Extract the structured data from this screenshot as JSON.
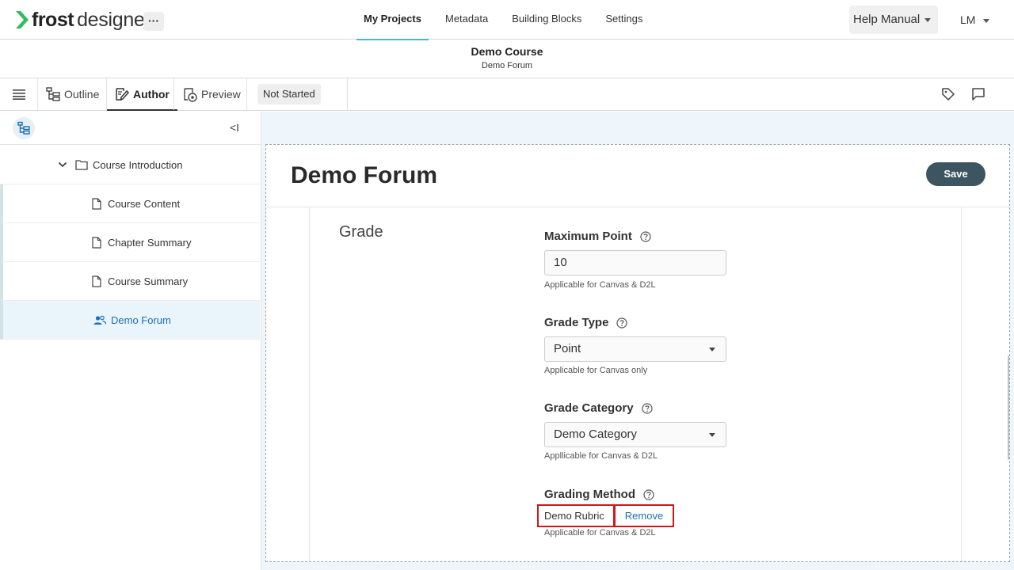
{
  "app": {
    "logo_bold": "frost",
    "logo_light": "designer",
    "more_label": "···"
  },
  "nav": {
    "items": [
      "My Projects",
      "Metadata",
      "Building Blocks",
      "Settings"
    ],
    "active": "My Projects"
  },
  "header_right": {
    "help_label": "Help Manual",
    "user_initials": "LM"
  },
  "course": {
    "title": "Demo Course",
    "subtitle": "Demo Forum"
  },
  "toolbar": {
    "outline_label": "Outline",
    "author_label": "Author",
    "preview_label": "Preview",
    "status_label": "Not Started"
  },
  "sidebar": {
    "collapse_label": "<I",
    "folder": "Course Introduction",
    "items": [
      {
        "label": "Course Content",
        "icon": "page-icon"
      },
      {
        "label": "Chapter Summary",
        "icon": "page-icon"
      },
      {
        "label": "Course Summary",
        "icon": "page-icon"
      },
      {
        "label": "Demo Forum",
        "icon": "people-icon",
        "selected": true
      }
    ]
  },
  "editor": {
    "title": "Demo Forum",
    "save_label": "Save",
    "section": "Grade",
    "fields": {
      "max_point": {
        "label": "Maximum Point",
        "value": "10",
        "hint": "Applicable for Canvas & D2L"
      },
      "grade_type": {
        "label": "Grade Type",
        "value": "Point",
        "hint": "Applicable for Canvas only"
      },
      "grade_category": {
        "label": "Grade Category",
        "value": "Demo Category",
        "hint": "Appllicable for Canvas & D2L"
      },
      "grading_method": {
        "label": "Grading Method",
        "value": "Demo Rubric",
        "remove_label": "Remove",
        "hint": "Applicable for Canvas & D2L"
      }
    }
  },
  "colors": {
    "accent": "#4ab8c9",
    "save_button": "#3d5560",
    "link": "#1d6fb8",
    "highlight_border": "#d0161e",
    "selected_row": "#eaf4fb"
  }
}
